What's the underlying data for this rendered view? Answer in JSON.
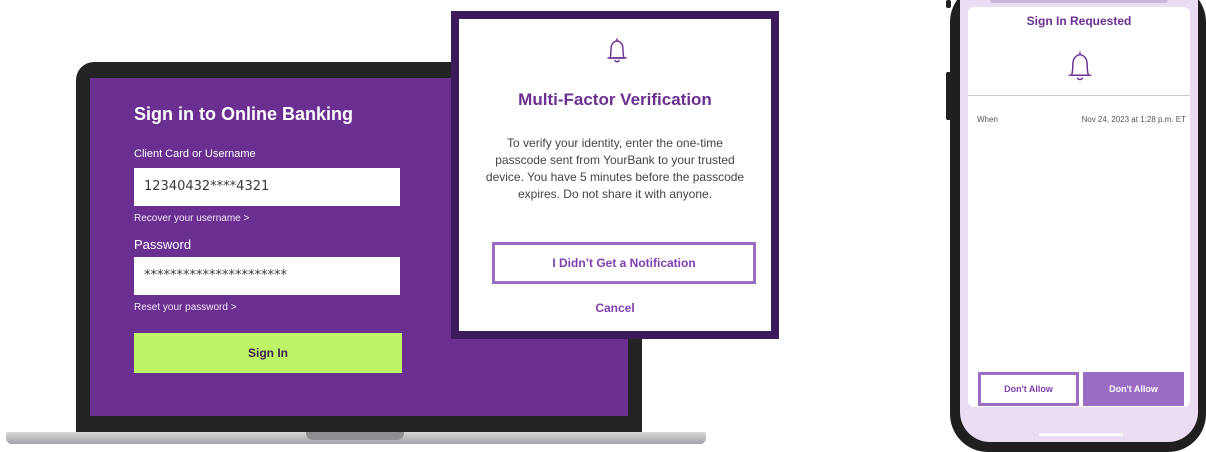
{
  "login": {
    "title": "Sign in to Online Banking",
    "username_label": "Client Card or Username",
    "username_value": "12340432****4321",
    "recover_link": "Recover your username >",
    "password_label": "Password",
    "password_value": "**********************",
    "reset_link": "Reset your password >",
    "sign_in_button": "Sign In"
  },
  "mfa_modal": {
    "icon": "bell-icon",
    "title": "Multi-Factor Verification",
    "body": "To verify your identity, enter the one-time passcode sent from YourBank to your trusted device. You have 5 minutes before the passcode expires. Do not share it with anyone.",
    "notification_button": "I Didn’t Get a Notification",
    "cancel_link": "Cancel"
  },
  "phone": {
    "title": "Sign In Requested",
    "icon": "bell-icon",
    "when_label": "When",
    "when_value": "Nov 24, 2023 at 1:28 p.m. ET",
    "deny_button_outline": "Don't Allow",
    "deny_button_solid": "Don't Allow"
  },
  "colors": {
    "brand_purple": "#6b2f91",
    "dark_purple": "#3d1b5b",
    "accent_purple": "#9b6cc4",
    "sign_in_green": "#bef267"
  }
}
